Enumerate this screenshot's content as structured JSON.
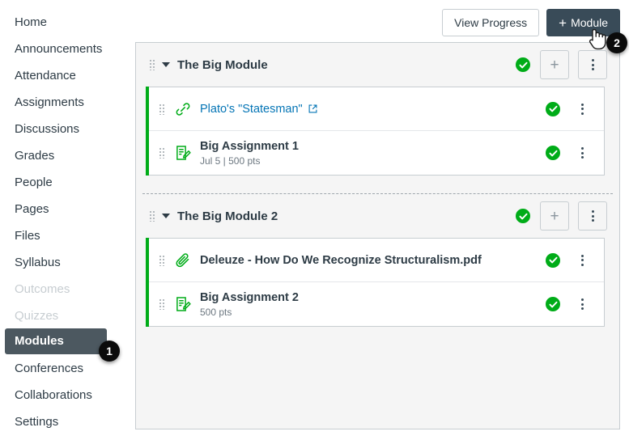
{
  "sidebar": {
    "items": [
      {
        "label": "Home",
        "state": "normal"
      },
      {
        "label": "Announcements",
        "state": "normal"
      },
      {
        "label": "Attendance",
        "state": "normal"
      },
      {
        "label": "Assignments",
        "state": "normal"
      },
      {
        "label": "Discussions",
        "state": "normal"
      },
      {
        "label": "Grades",
        "state": "normal"
      },
      {
        "label": "People",
        "state": "normal"
      },
      {
        "label": "Pages",
        "state": "normal"
      },
      {
        "label": "Files",
        "state": "normal"
      },
      {
        "label": "Syllabus",
        "state": "normal"
      },
      {
        "label": "Outcomes",
        "state": "disabled"
      },
      {
        "label": "Quizzes",
        "state": "disabled"
      },
      {
        "label": "Modules",
        "state": "active"
      },
      {
        "label": "Conferences",
        "state": "normal"
      },
      {
        "label": "Collaborations",
        "state": "normal"
      },
      {
        "label": "Settings",
        "state": "normal"
      }
    ]
  },
  "toolbar": {
    "view_progress_label": "View Progress",
    "add_module_label": "Module",
    "add_module_plus": "+"
  },
  "modules": [
    {
      "title": "The Big Module",
      "published": true,
      "add_icon": "plus-icon",
      "menu_icon": "kebab-menu-icon",
      "items": [
        {
          "title": "Plato's \"Statesman\"",
          "subtitle": "",
          "type": "external-url",
          "icon": "link-icon",
          "is_link": true,
          "external": true,
          "published": true
        },
        {
          "title": "Big Assignment 1",
          "subtitle": "Jul 5  |  500 pts",
          "type": "assignment",
          "icon": "assignment-icon",
          "is_link": false,
          "external": false,
          "published": true
        }
      ]
    },
    {
      "title": "The Big Module 2",
      "published": true,
      "add_icon": "plus-icon",
      "menu_icon": "kebab-menu-icon",
      "items": [
        {
          "title": "Deleuze - How Do We Recognize Structuralism.pdf",
          "subtitle": "",
          "type": "file",
          "icon": "paperclip-icon",
          "is_link": false,
          "external": false,
          "published": true
        },
        {
          "title": "Big Assignment 2",
          "subtitle": "500 pts",
          "type": "assignment",
          "icon": "assignment-icon",
          "is_link": false,
          "external": false,
          "published": true
        }
      ]
    }
  ],
  "callouts": [
    {
      "number": "1",
      "target": "sidebar-item-modules"
    },
    {
      "number": "2",
      "target": "add-module-button"
    }
  ],
  "colors": {
    "published_green": "#00ac18",
    "active_nav_bg": "#4c5860",
    "primary_button_bg": "#394B58",
    "link_blue": "#0374B5",
    "panel_bg": "#f5f5f5",
    "border_gray": "#c7cdd1",
    "text_dark": "#2d3b45"
  }
}
